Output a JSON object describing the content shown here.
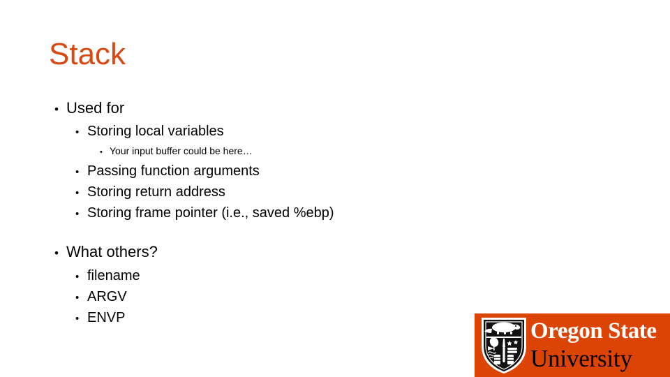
{
  "slide": {
    "title": "Stack",
    "title_color": "#D94A12",
    "background_color": "#FFFFFF"
  },
  "content": {
    "sections": [
      {
        "items": [
          {
            "level": 1,
            "text": "Used for"
          },
          {
            "level": 2,
            "text": "Storing local variables"
          },
          {
            "level": 3,
            "text": "Your input buffer could be here…"
          },
          {
            "level": 2,
            "text": "Passing function arguments"
          },
          {
            "level": 2,
            "text": "Storing return address"
          },
          {
            "level": 2,
            "text": "Storing frame pointer (i.e., saved %ebp)"
          }
        ]
      },
      {
        "items": [
          {
            "level": 1,
            "text": "What others?"
          },
          {
            "level": 2,
            "text": "filename"
          },
          {
            "level": 2,
            "text": "ARGV"
          },
          {
            "level": 2,
            "text": "ENVP"
          }
        ]
      }
    ],
    "bullet_glyph": "•"
  },
  "logo": {
    "line1": "Oregon State",
    "line2": "University",
    "background_color": "#DC4405",
    "line1_color": "#FFFFFF",
    "line2_color": "#000000",
    "shield_name": "osu-beaver-shield-icon"
  }
}
